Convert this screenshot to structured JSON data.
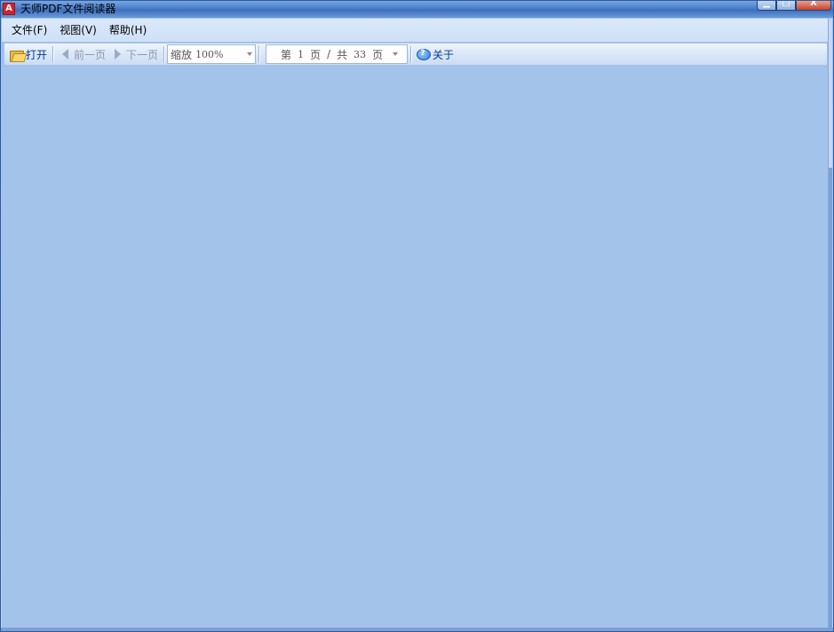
{
  "window": {
    "title": "天师PDF文件阅读器",
    "icon": "pdf-app-icon",
    "icon_letter": "A",
    "controls": {
      "minimize": "minimize-icon",
      "maximize": "maximize-icon",
      "close": "close-icon",
      "minimize_glyph": "▁",
      "maximize_glyph": "□",
      "close_glyph": "X"
    }
  },
  "menubar": {
    "items": [
      {
        "label": "文件(F)"
      },
      {
        "label": "视图(V)"
      },
      {
        "label": "帮助(H)"
      }
    ]
  },
  "toolbar": {
    "open_label": "打开",
    "prev_label": "前一页",
    "next_label": "下一页",
    "zoom": {
      "label": "缩放",
      "value": "100%"
    },
    "page": {
      "prefix": "第",
      "current": "1",
      "unit": "页",
      "separator": "/",
      "total_prefix": "共",
      "total": "33",
      "total_unit": "页"
    },
    "about_label": "关于",
    "about_icon_glyph": "?"
  },
  "colors": {
    "content_bg": "#a3c3ea",
    "link_text": "#003b8e",
    "disabled_text": "#8b98ab"
  }
}
